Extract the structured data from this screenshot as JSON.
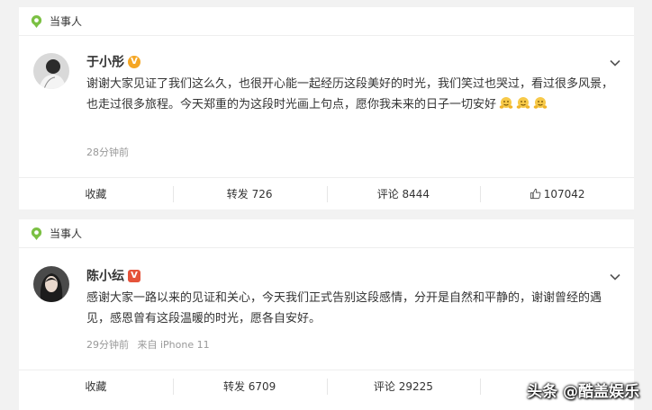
{
  "posts": [
    {
      "tag": "当事人",
      "user_name": "于小彤",
      "badge": "V",
      "text": "谢谢大家见证了我们这么久，也很开心能一起经历这段美好的时光，我们笑过也哭过，看过很多风景，也走过很多旅程。今天郑重的为这段时光画上句点，愿你我未来的日子一切安好",
      "time": "28分钟前",
      "source": "",
      "actions": {
        "collect": "收藏",
        "repost": "转发 726",
        "comment": "评论 8444",
        "like": "107042"
      }
    },
    {
      "tag": "当事人",
      "user_name": "陈小纭",
      "badge": "V",
      "text": "感谢大家一路以来的见证和关心，今天我们正式告别这段感情，分开是自然和平静的，谢谢曾经的遇见，感恩曾有这段温暖的时光，愿各自安好。",
      "time": "29分钟前",
      "source": "来自 iPhone 11",
      "actions": {
        "collect": "收藏",
        "repost": "转发 6709",
        "comment": "评论 29225",
        "like": ""
      }
    }
  ],
  "watermark": "头条 @酷盖娱乐",
  "colors": {
    "tag_green": "#7bc043",
    "gold_badge": "#f5a623",
    "red_badge": "#e5533a"
  }
}
